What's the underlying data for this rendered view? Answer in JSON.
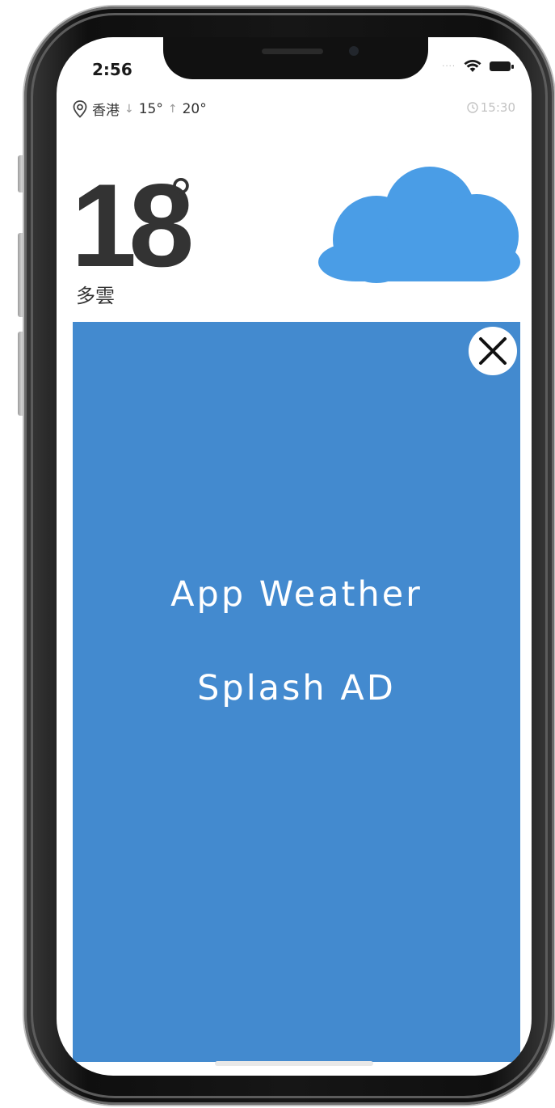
{
  "status_bar": {
    "time": "2:56",
    "signal_icon": "dots",
    "wifi_icon": "wifi-icon",
    "battery_icon": "battery-icon"
  },
  "weather": {
    "location": "香港",
    "low": "15°",
    "high": "20°",
    "updated": "15:30",
    "temperature": "18",
    "temperature_unit": "°",
    "condition": "多雲",
    "condition_icon": "cloud-icon",
    "cloud_color": "#4a9de6"
  },
  "ad": {
    "line1": "App Weather",
    "line2": "Splash AD",
    "background": "#438acf",
    "close_icon": "close-icon"
  }
}
